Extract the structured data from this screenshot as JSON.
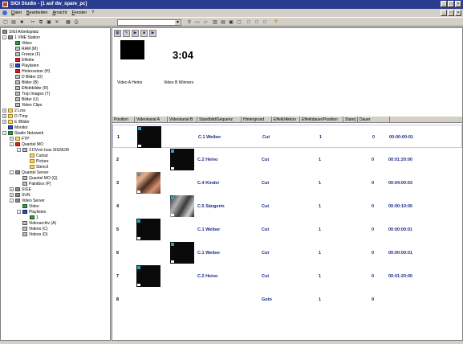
{
  "window": {
    "title": "SIGI Studio - [1 auf dw_spare_pc]"
  },
  "menu": {
    "items": [
      "Datei",
      "Bearbeiten",
      "Ansicht",
      "Fenster",
      "?"
    ]
  },
  "tree": {
    "items": [
      {
        "label": "SIGI Arbeitsplatz",
        "icon": "workplace-icon"
      },
      {
        "label": "1 VME Station",
        "icon": "station-icon"
      },
      {
        "label": "Video",
        "icon": "video-icon"
      },
      {
        "label": "RAM (M)",
        "icon": "drive-icon"
      },
      {
        "label": "Freeze (F)",
        "icon": "drive-icon"
      },
      {
        "label": "Effekte",
        "icon": "effects-icon"
      },
      {
        "label": "Playlisten",
        "icon": "playlist-icon"
      },
      {
        "label": "Hintersetzer (H)",
        "icon": "drive-icon"
      },
      {
        "label": "D Bilder (D)",
        "icon": "drive-icon"
      },
      {
        "label": "Bilder (B)",
        "icon": "drive-icon"
      },
      {
        "label": "Effektbilder (R)",
        "icon": "drive-icon"
      },
      {
        "label": "Trsp Images (T)",
        "icon": "drive-icon"
      },
      {
        "label": "Bilder (U)",
        "icon": "drive-icon"
      },
      {
        "label": "Video Clips",
        "icon": "drive-icon"
      },
      {
        "label": "2 Lms",
        "icon": "folder-icon"
      },
      {
        "label": "D /Tmp",
        "icon": "folder-icon"
      },
      {
        "label": "E /Bilder",
        "icon": "folder-icon"
      },
      {
        "label": "Monitor",
        "icon": "monitor-icon"
      },
      {
        "label": "Studio Netzwerk",
        "icon": "network-icon"
      },
      {
        "label": "FTP",
        "icon": "folder-icon"
      },
      {
        "label": "Quantel MO",
        "icon": "quantel-icon"
      },
      {
        "label": "3 DVs\\n Isas SIGNUM",
        "icon": "drive-icon"
      },
      {
        "label": "Cutout",
        "icon": "folder-icon"
      },
      {
        "label": "Picture",
        "icon": "folder-icon"
      },
      {
        "label": "Stencil",
        "icon": "folder-icon"
      },
      {
        "label": "Quantel Server",
        "icon": "server-icon"
      },
      {
        "label": "Quantel MO (Q)",
        "icon": "drive-icon"
      },
      {
        "label": "Paintbox (P)",
        "icon": "drive-icon"
      },
      {
        "label": "SIGE",
        "icon": "server-icon"
      },
      {
        "label": "SUN",
        "icon": "server-icon"
      },
      {
        "label": "Video Server",
        "icon": "server-icon"
      },
      {
        "label": "Video",
        "icon": "video-icon"
      },
      {
        "label": "Playlisten",
        "icon": "playlist-icon"
      },
      {
        "label": "1",
        "icon": "playlist-item-icon"
      },
      {
        "label": "Videoarchiv (A)",
        "icon": "drive-icon"
      },
      {
        "label": "Videos (C)",
        "icon": "drive-icon"
      },
      {
        "label": "Videos (D)",
        "icon": "drive-icon"
      }
    ]
  },
  "preview": {
    "time": "3:04",
    "label_a": "Video A Heino",
    "label_b": "Video B Winners"
  },
  "grid": {
    "columns": [
      "Position",
      "Videokanal A",
      "Videokanal B",
      "Standbild/Sequenz",
      "Hintergrund",
      "Effekt/Aktion",
      "Effektdauer/Position",
      "Stand...",
      "Dauer"
    ],
    "rows": [
      {
        "pos": "1",
        "scene": "C.1 Weiber",
        "effect": "Cut",
        "eff_pos": "1",
        "stand": "0",
        "dur": "00:00:00:01",
        "thumb": "a",
        "style": "dark"
      },
      {
        "pos": "2",
        "scene": "C.2 Heino",
        "effect": "Cut",
        "eff_pos": "1",
        "stand": "0",
        "dur": "00:01:20:00",
        "thumb": "b",
        "style": "dark"
      },
      {
        "pos": "3",
        "scene": "C.4 Kinder",
        "effect": "Cut",
        "eff_pos": "1",
        "stand": "0",
        "dur": "00:04:00:03",
        "thumb": "a",
        "style": "img"
      },
      {
        "pos": "4",
        "scene": "C.5 Sängerin",
        "effect": "Cut",
        "eff_pos": "1",
        "stand": "0",
        "dur": "00:00:10:00",
        "thumb": "b",
        "style": "img2"
      },
      {
        "pos": "5",
        "scene": "C.1 Weiber",
        "effect": "Cut",
        "eff_pos": "1",
        "stand": "0",
        "dur": "00:00:00:01",
        "thumb": "a",
        "style": "dark"
      },
      {
        "pos": "6",
        "scene": "C.1 Weiber",
        "effect": "Cut",
        "eff_pos": "1",
        "stand": "0",
        "dur": "00:00:00:01",
        "thumb": "b",
        "style": "dark"
      },
      {
        "pos": "7",
        "scene": "C.2 Heino",
        "effect": "Cut",
        "eff_pos": "1",
        "stand": "0",
        "dur": "00:01:20:00",
        "thumb": "a",
        "style": "dark"
      },
      {
        "pos": "8",
        "scene": "",
        "effect": "Goto",
        "eff_pos": "1",
        "stand": "9",
        "dur": "",
        "thumb": "",
        "style": ""
      }
    ]
  }
}
